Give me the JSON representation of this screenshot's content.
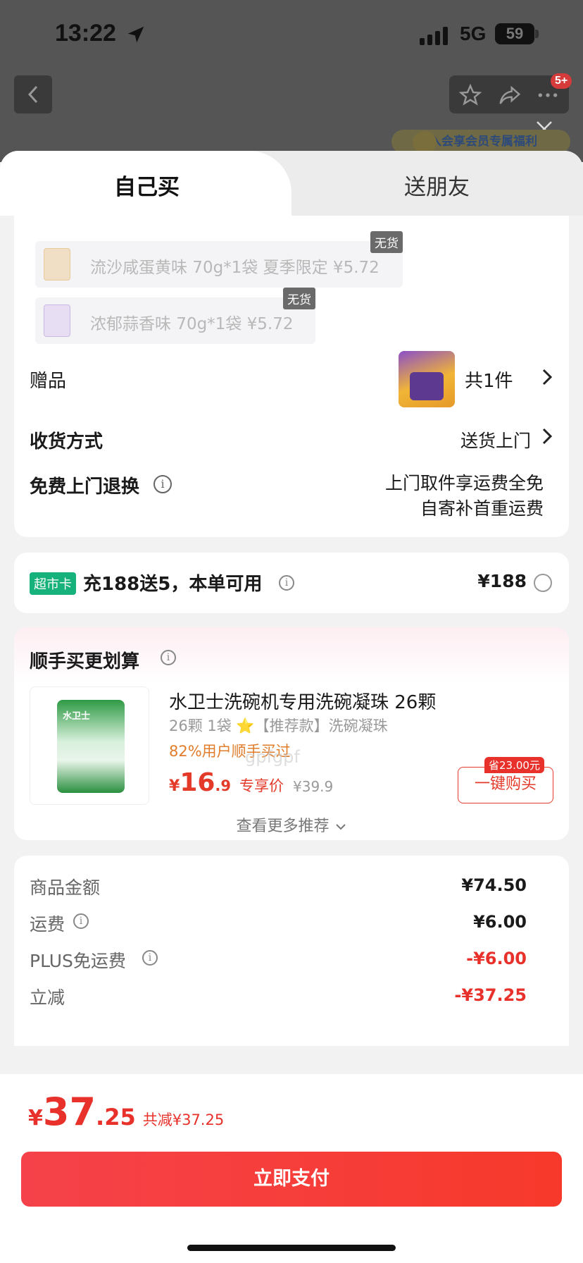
{
  "status_bar": {
    "time": "13:22",
    "network": "5G",
    "battery": "59"
  },
  "header": {
    "badge_count": "5+",
    "promo_text": "入会享会员专属福利"
  },
  "tabs": [
    {
      "label": "自己买"
    },
    {
      "label": "送朋友"
    }
  ],
  "variants": [
    {
      "text": "流沙咸蛋黄味 70g*1袋 夏季限定  ¥5.72",
      "badge": "无货"
    },
    {
      "text": "浓郁蒜香味 70g*1袋  ¥5.72",
      "badge": "无货"
    }
  ],
  "gift": {
    "label": "赠品",
    "count": "共1件"
  },
  "delivery": {
    "label": "收货方式",
    "value": "送货上门"
  },
  "returns": {
    "label": "免费上门退换",
    "line1": "上门取件享运费全免",
    "line2": "自寄补首重运费"
  },
  "market_card": {
    "tag": "超市卡",
    "text": "充188送5，本单可用",
    "price": "¥188"
  },
  "watermark": "gpfgpf",
  "recommend": {
    "title": "顺手买更划算",
    "product": {
      "name": "水卫士洗碗机专用洗碗凝珠 26颗",
      "spec": "26颗 1袋 ⭐【推荐款】洗碗凝珠",
      "rate": "82%用户顺手买过",
      "currency": "¥",
      "price_int": "16",
      "price_dec": ".9",
      "price_label": "专享价",
      "original": "¥39.9",
      "save_badge": "省23.00元",
      "buy_label": "一键购买",
      "pack_text": "水卫士"
    },
    "more_label": "查看更多推荐"
  },
  "summary": [
    {
      "label": "商品金额",
      "value": "¥74.50",
      "info": false,
      "red": false
    },
    {
      "label": "运费",
      "value": "¥6.00",
      "info": true,
      "red": false
    },
    {
      "label": "PLUS免运费",
      "value": "-¥6.00",
      "info": true,
      "red": true
    },
    {
      "label": "立减",
      "value": "-¥37.25",
      "info": false,
      "red": true
    }
  ],
  "total": {
    "currency": "¥",
    "int": "37",
    "dec": ".25",
    "saved": "共减¥37.25"
  },
  "pay_button": "立即支付",
  "colors": {
    "accent_red": "#e8312b",
    "green_tag": "#17b27b",
    "orange": "#e07c2a"
  }
}
